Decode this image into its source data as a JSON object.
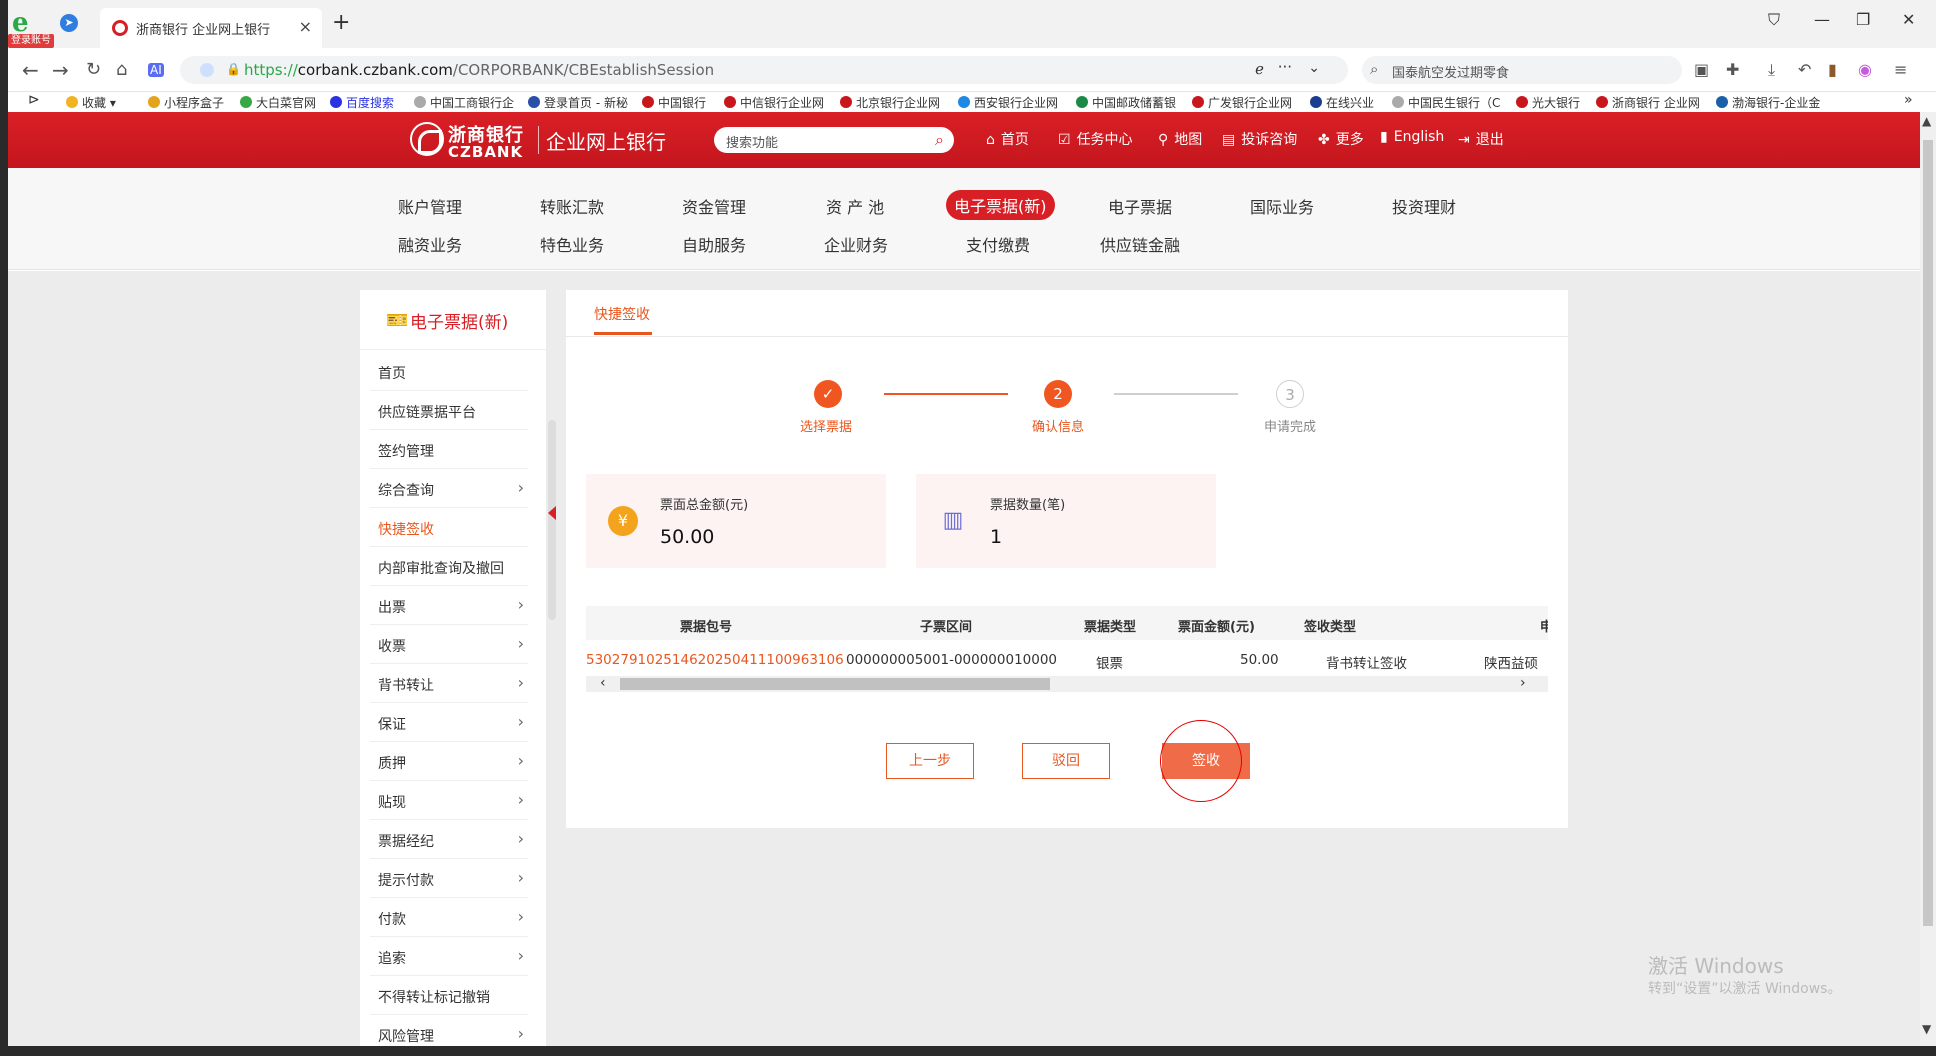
{
  "browser": {
    "login_badge": "登录账号",
    "tab_title": "浙商银行 企业网上银行",
    "tab_close": "×",
    "new_tab": "+",
    "url_scheme": "https://",
    "url_domain": "corbank.czbank.com",
    "url_path": "/CORPORBANK/CBEstablishSession",
    "search_text": "国泰航空发过期零食"
  },
  "bookmarks": [
    "收藏",
    "小程序盒子",
    "大白菜官网",
    "百度搜索",
    "中国工商银行企",
    "登录首页 - 新秘",
    "中国银行",
    "中信银行企业网",
    "北京银行企业网",
    "西安银行企业网",
    "中国邮政储蓄银",
    "广发银行企业网",
    "在线兴业",
    "中国民生银行（C",
    "光大银行",
    "浙商银行 企业网",
    "渤海银行-企业金"
  ],
  "header": {
    "logo_cn": "浙商银行",
    "logo_en": "CZBANK",
    "portal_title": "企业网上银行",
    "search_placeholder": "搜索功能",
    "nav": [
      "首页",
      "任务中心",
      "地图",
      "投诉咨询",
      "更多",
      "English",
      "退出"
    ]
  },
  "main_menu": {
    "row1": [
      "账户管理",
      "转账汇款",
      "资金管理",
      "资 产 池",
      "电子票据(新)",
      "电子票据",
      "国际业务",
      "投资理财"
    ],
    "row2": [
      "融资业务",
      "特色业务",
      "自助服务",
      "企业财务",
      "支付缴费",
      "供应链金融"
    ],
    "active": "电子票据(新)"
  },
  "sidebar": {
    "title": "电子票据(新)",
    "items": [
      {
        "label": "首页",
        "chev": false
      },
      {
        "label": "供应链票据平台",
        "chev": false
      },
      {
        "label": "签约管理",
        "chev": false
      },
      {
        "label": "综合查询",
        "chev": true
      },
      {
        "label": "快捷签收",
        "chev": false,
        "active": true
      },
      {
        "label": "内部审批查询及撤回",
        "chev": false
      },
      {
        "label": "出票",
        "chev": true
      },
      {
        "label": "收票",
        "chev": true
      },
      {
        "label": "背书转让",
        "chev": true
      },
      {
        "label": "保证",
        "chev": true
      },
      {
        "label": "质押",
        "chev": true
      },
      {
        "label": "贴现",
        "chev": true
      },
      {
        "label": "票据经纪",
        "chev": true
      },
      {
        "label": "提示付款",
        "chev": true
      },
      {
        "label": "付款",
        "chev": true
      },
      {
        "label": "追索",
        "chev": true
      },
      {
        "label": "不得转让标记撤销",
        "chev": false
      },
      {
        "label": "风险管理",
        "chev": true
      }
    ]
  },
  "panel": {
    "tab": "快捷签收",
    "steps": [
      {
        "label": "选择票据",
        "mark": "✓",
        "state": "done"
      },
      {
        "label": "确认信息",
        "mark": "2",
        "state": "current"
      },
      {
        "label": "申请完成",
        "mark": "3",
        "state": "todo"
      }
    ],
    "summary": {
      "amount_label": "票面总金额(元)",
      "amount_value": "50.00",
      "count_label": "票据数量(笔)",
      "count_value": "1"
    },
    "table": {
      "headers": [
        "票据包号",
        "子票区间",
        "票据类型",
        "票面金额(元)",
        "签收类型",
        "申"
      ],
      "row": [
        "530279102514620250411100963106",
        "000000005001-000000010000",
        "银票",
        "50.00",
        "背书转让签收",
        "陕西益硕"
      ]
    },
    "buttons": {
      "prev": "上一步",
      "reject": "驳回",
      "sign": "签收"
    }
  },
  "watermark": {
    "line1": "激活 Windows",
    "line2": "转到“设置”以激活 Windows。"
  },
  "colors": {
    "brand_red": "#d81f26",
    "accent_orange": "#e8571f"
  }
}
